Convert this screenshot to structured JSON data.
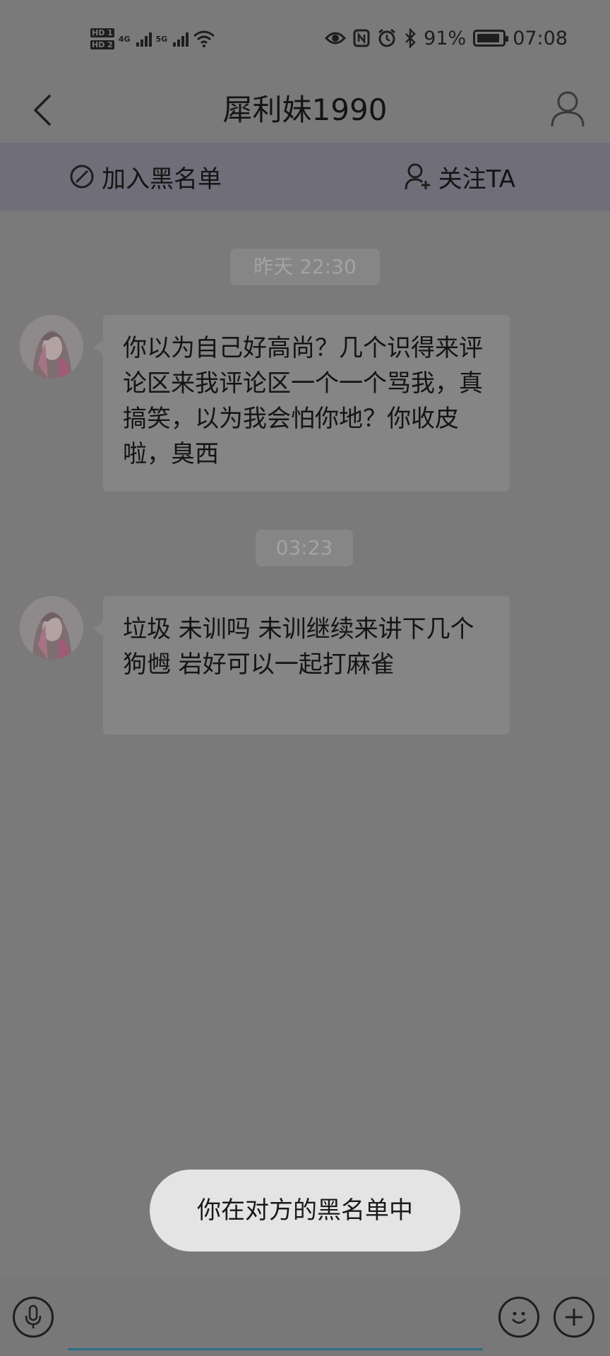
{
  "status_bar": {
    "sim1": "HD 1",
    "sim2": "HD 2",
    "net1": "4G",
    "net2": "5G",
    "battery_percent": "91%",
    "battery_level": 0.91,
    "time": "07:08",
    "icons": [
      "eye-icon",
      "nfc-icon",
      "alarm-icon",
      "bluetooth-icon",
      "wifi-icon"
    ]
  },
  "header": {
    "title": "犀利妹1990",
    "back_icon": "chevron-left-icon",
    "profile_icon": "user-icon"
  },
  "action_bar": {
    "blacklist_label": "加入黑名单",
    "follow_label": "关注TA"
  },
  "messages": [
    {
      "timestamp": "昨天 22:30",
      "text": "你以为自己好高尚？几个识得来评论区来我评论区一个一个骂我，真搞笑，以为我会怕你地？你收皮啦，臭西"
    },
    {
      "timestamp": "03:23",
      "text": "垃圾 未训吗 未训继续来讲下几个狗乸 岩好可以一起打麻雀"
    }
  ],
  "toast": {
    "text": "你在对方的黑名单中"
  },
  "input_bar": {
    "placeholder": "",
    "value": ""
  },
  "colors": {
    "overlay_bg": "#7a7a7a",
    "action_bar_bg": "#6f6e79",
    "bubble_bg": "#858585",
    "toast_bg": "#e4e4e4",
    "input_underline": "#2b6f86"
  }
}
